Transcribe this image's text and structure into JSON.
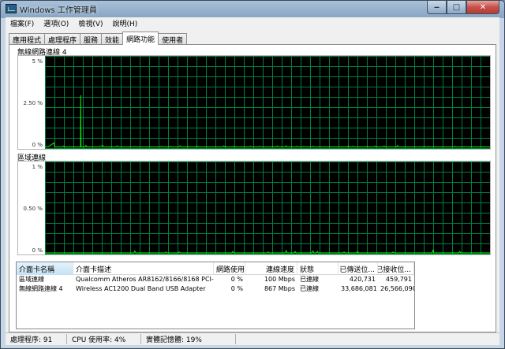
{
  "window": {
    "title": "Windows 工作管理員"
  },
  "menu": [
    "檔案(F)",
    "選項(O)",
    "檢視(V)",
    "說明(H)"
  ],
  "tabs": [
    {
      "label": "應用程式",
      "active": false
    },
    {
      "label": "處理程序",
      "active": false
    },
    {
      "label": "服務",
      "active": false
    },
    {
      "label": "效能",
      "active": false
    },
    {
      "label": "網路功能",
      "active": true
    },
    {
      "label": "使用者",
      "active": false
    }
  ],
  "graphs": [
    {
      "name": "無線網路連線 4",
      "y_labels": [
        "5 %",
        "2.50 %",
        "0 %"
      ],
      "ymax": 5,
      "samples": [
        [
          0.0,
          0.02
        ],
        [
          0.04,
          0.03
        ],
        [
          0.1,
          0.25
        ],
        [
          0.11,
          0.02
        ],
        [
          0.2,
          0.02
        ],
        [
          0.21,
          0.07
        ],
        [
          0.22,
          0.02
        ],
        [
          0.4,
          0.02
        ],
        [
          0.401,
          2.9
        ],
        [
          0.405,
          0.02
        ],
        [
          0.45,
          0.02
        ],
        [
          0.46,
          0.1
        ],
        [
          0.47,
          0.02
        ],
        [
          0.6,
          0.02
        ],
        [
          0.61,
          0.02
        ],
        [
          0.65,
          0.1
        ],
        [
          0.66,
          0.02
        ],
        [
          0.7,
          0.02
        ],
        [
          0.8,
          0.02
        ],
        [
          0.81,
          0.08
        ],
        [
          0.82,
          0.02
        ],
        [
          1.0,
          0.02
        ],
        [
          1.01,
          0.05
        ],
        [
          1.02,
          0.02
        ],
        [
          1.3,
          0.02
        ],
        [
          1.31,
          0.06
        ],
        [
          1.32,
          0.02
        ],
        [
          1.4,
          0.02
        ],
        [
          1.41,
          0.06
        ],
        [
          1.42,
          0.02
        ],
        [
          1.5,
          0.02
        ],
        [
          1.52,
          0.08
        ],
        [
          1.53,
          0.02
        ],
        [
          1.6,
          0.02
        ],
        [
          1.61,
          0.05
        ],
        [
          1.62,
          0.02
        ],
        [
          1.7,
          0.02
        ],
        [
          1.71,
          0.07
        ],
        [
          1.72,
          0.02
        ],
        [
          2.0,
          0.02
        ],
        [
          2.01,
          0.08
        ],
        [
          2.02,
          0.02
        ],
        [
          2.1,
          0.02
        ],
        [
          2.11,
          0.05
        ],
        [
          2.12,
          0.02
        ],
        [
          2.3,
          0.02
        ],
        [
          2.31,
          0.06
        ],
        [
          2.32,
          0.02
        ],
        [
          2.4,
          0.02
        ],
        [
          2.41,
          0.06
        ],
        [
          2.42,
          0.02
        ],
        [
          2.55,
          0.02
        ],
        [
          2.56,
          0.05
        ],
        [
          2.57,
          0.02
        ],
        [
          2.6,
          0.02
        ],
        [
          2.61,
          0.07
        ],
        [
          2.62,
          0.02
        ],
        [
          2.7,
          0.02
        ],
        [
          2.71,
          0.08
        ],
        [
          2.72,
          0.02
        ],
        [
          2.82,
          0.02
        ],
        [
          2.83,
          0.06
        ],
        [
          2.84,
          0.02
        ],
        [
          2.9,
          0.02
        ],
        [
          2.91,
          0.05
        ],
        [
          2.92,
          0.02
        ],
        [
          3.0,
          0.02
        ],
        [
          3.01,
          0.06
        ],
        [
          3.02,
          0.02
        ],
        [
          3.4,
          0.02
        ],
        [
          3.41,
          0.08
        ],
        [
          3.42,
          0.02
        ],
        [
          3.45,
          0.02
        ],
        [
          3.46,
          0.06
        ],
        [
          3.47,
          0.02
        ],
        [
          3.6,
          0.02
        ],
        [
          3.61,
          0.05
        ],
        [
          3.62,
          0.02
        ],
        [
          3.7,
          0.02
        ],
        [
          3.71,
          0.07
        ],
        [
          3.72,
          0.02
        ],
        [
          3.8,
          0.02
        ],
        [
          3.81,
          0.08
        ],
        [
          3.82,
          0.02
        ],
        [
          3.95,
          0.02
        ],
        [
          3.96,
          0.1
        ],
        [
          3.97,
          0.02
        ],
        [
          4.25,
          0.02
        ],
        [
          4.26,
          0.06
        ],
        [
          4.27,
          0.02
        ],
        [
          4.3,
          0.02
        ],
        [
          4.31,
          0.05
        ],
        [
          4.32,
          0.02
        ],
        [
          4.38,
          0.02
        ],
        [
          4.39,
          0.04
        ],
        [
          4.4,
          0.02
        ],
        [
          4.6,
          0.02
        ],
        [
          4.61,
          0.05
        ],
        [
          4.62,
          0.02
        ],
        [
          4.7,
          0.02
        ],
        [
          4.71,
          0.04
        ],
        [
          4.72,
          0.02
        ],
        [
          5.0,
          0.02
        ]
      ]
    },
    {
      "name": "區域連線",
      "y_labels": [
        "1 %",
        "0.50 %",
        "0 %"
      ],
      "ymax": 1,
      "samples": [
        [
          0.0,
          0.0
        ],
        [
          1.0,
          0.0
        ],
        [
          1.01,
          0.02
        ],
        [
          1.02,
          0.0
        ],
        [
          1.35,
          0.0
        ],
        [
          1.36,
          0.01
        ],
        [
          1.37,
          0.0
        ],
        [
          1.5,
          0.0
        ],
        [
          1.51,
          0.01
        ],
        [
          1.52,
          0.0
        ],
        [
          2.1,
          0.0
        ],
        [
          2.11,
          0.015
        ],
        [
          2.12,
          0.0
        ],
        [
          2.5,
          0.0
        ],
        [
          2.51,
          0.01
        ],
        [
          2.52,
          0.0
        ],
        [
          2.7,
          0.0
        ],
        [
          2.71,
          0.025
        ],
        [
          2.72,
          0.0
        ],
        [
          2.8,
          0.0
        ],
        [
          2.81,
          0.015
        ],
        [
          2.82,
          0.0
        ],
        [
          3.0,
          0.0
        ],
        [
          3.01,
          0.02
        ],
        [
          3.02,
          0.0
        ],
        [
          3.05,
          0.0
        ],
        [
          3.06,
          0.015
        ],
        [
          3.07,
          0.0
        ],
        [
          3.35,
          0.0
        ],
        [
          3.36,
          0.01
        ],
        [
          3.37,
          0.0
        ],
        [
          3.5,
          0.0
        ],
        [
          3.51,
          0.015
        ],
        [
          3.52,
          0.0
        ],
        [
          3.9,
          0.0
        ],
        [
          3.91,
          0.01
        ],
        [
          3.92,
          0.0
        ],
        [
          4.35,
          0.0
        ],
        [
          4.36,
          0.03
        ],
        [
          4.37,
          0.0
        ],
        [
          4.65,
          0.0
        ],
        [
          4.66,
          0.015
        ],
        [
          4.67,
          0.0
        ],
        [
          5.0,
          0.0
        ]
      ]
    }
  ],
  "list": {
    "columns": [
      "介面卡名稱",
      "介面卡描述",
      "網路使用",
      "連線速度",
      "狀態",
      "已傳送位...",
      "已接收位..."
    ],
    "rows": [
      [
        "區域連線",
        "Qualcomm Atheros AR8162/8166/8168 PCI-E ...",
        "0 %",
        "100 Mbps",
        "已連線",
        "420,731",
        "459,791"
      ],
      [
        "無線網路連線 4",
        "Wireless AC1200 Dual Band USB Adapter",
        "0 %",
        "867 Mbps",
        "已連線",
        "33,686,081",
        "26,566,090"
      ]
    ]
  },
  "status": {
    "processes": "處理程序: 91",
    "cpu": "CPU 使用率: 4%",
    "memory": "實體記憶體: 19%"
  },
  "colors": {
    "grid_bg": "#000000",
    "grid_line": "#008040",
    "trace": "#00ff00",
    "label": "#ffff00"
  }
}
